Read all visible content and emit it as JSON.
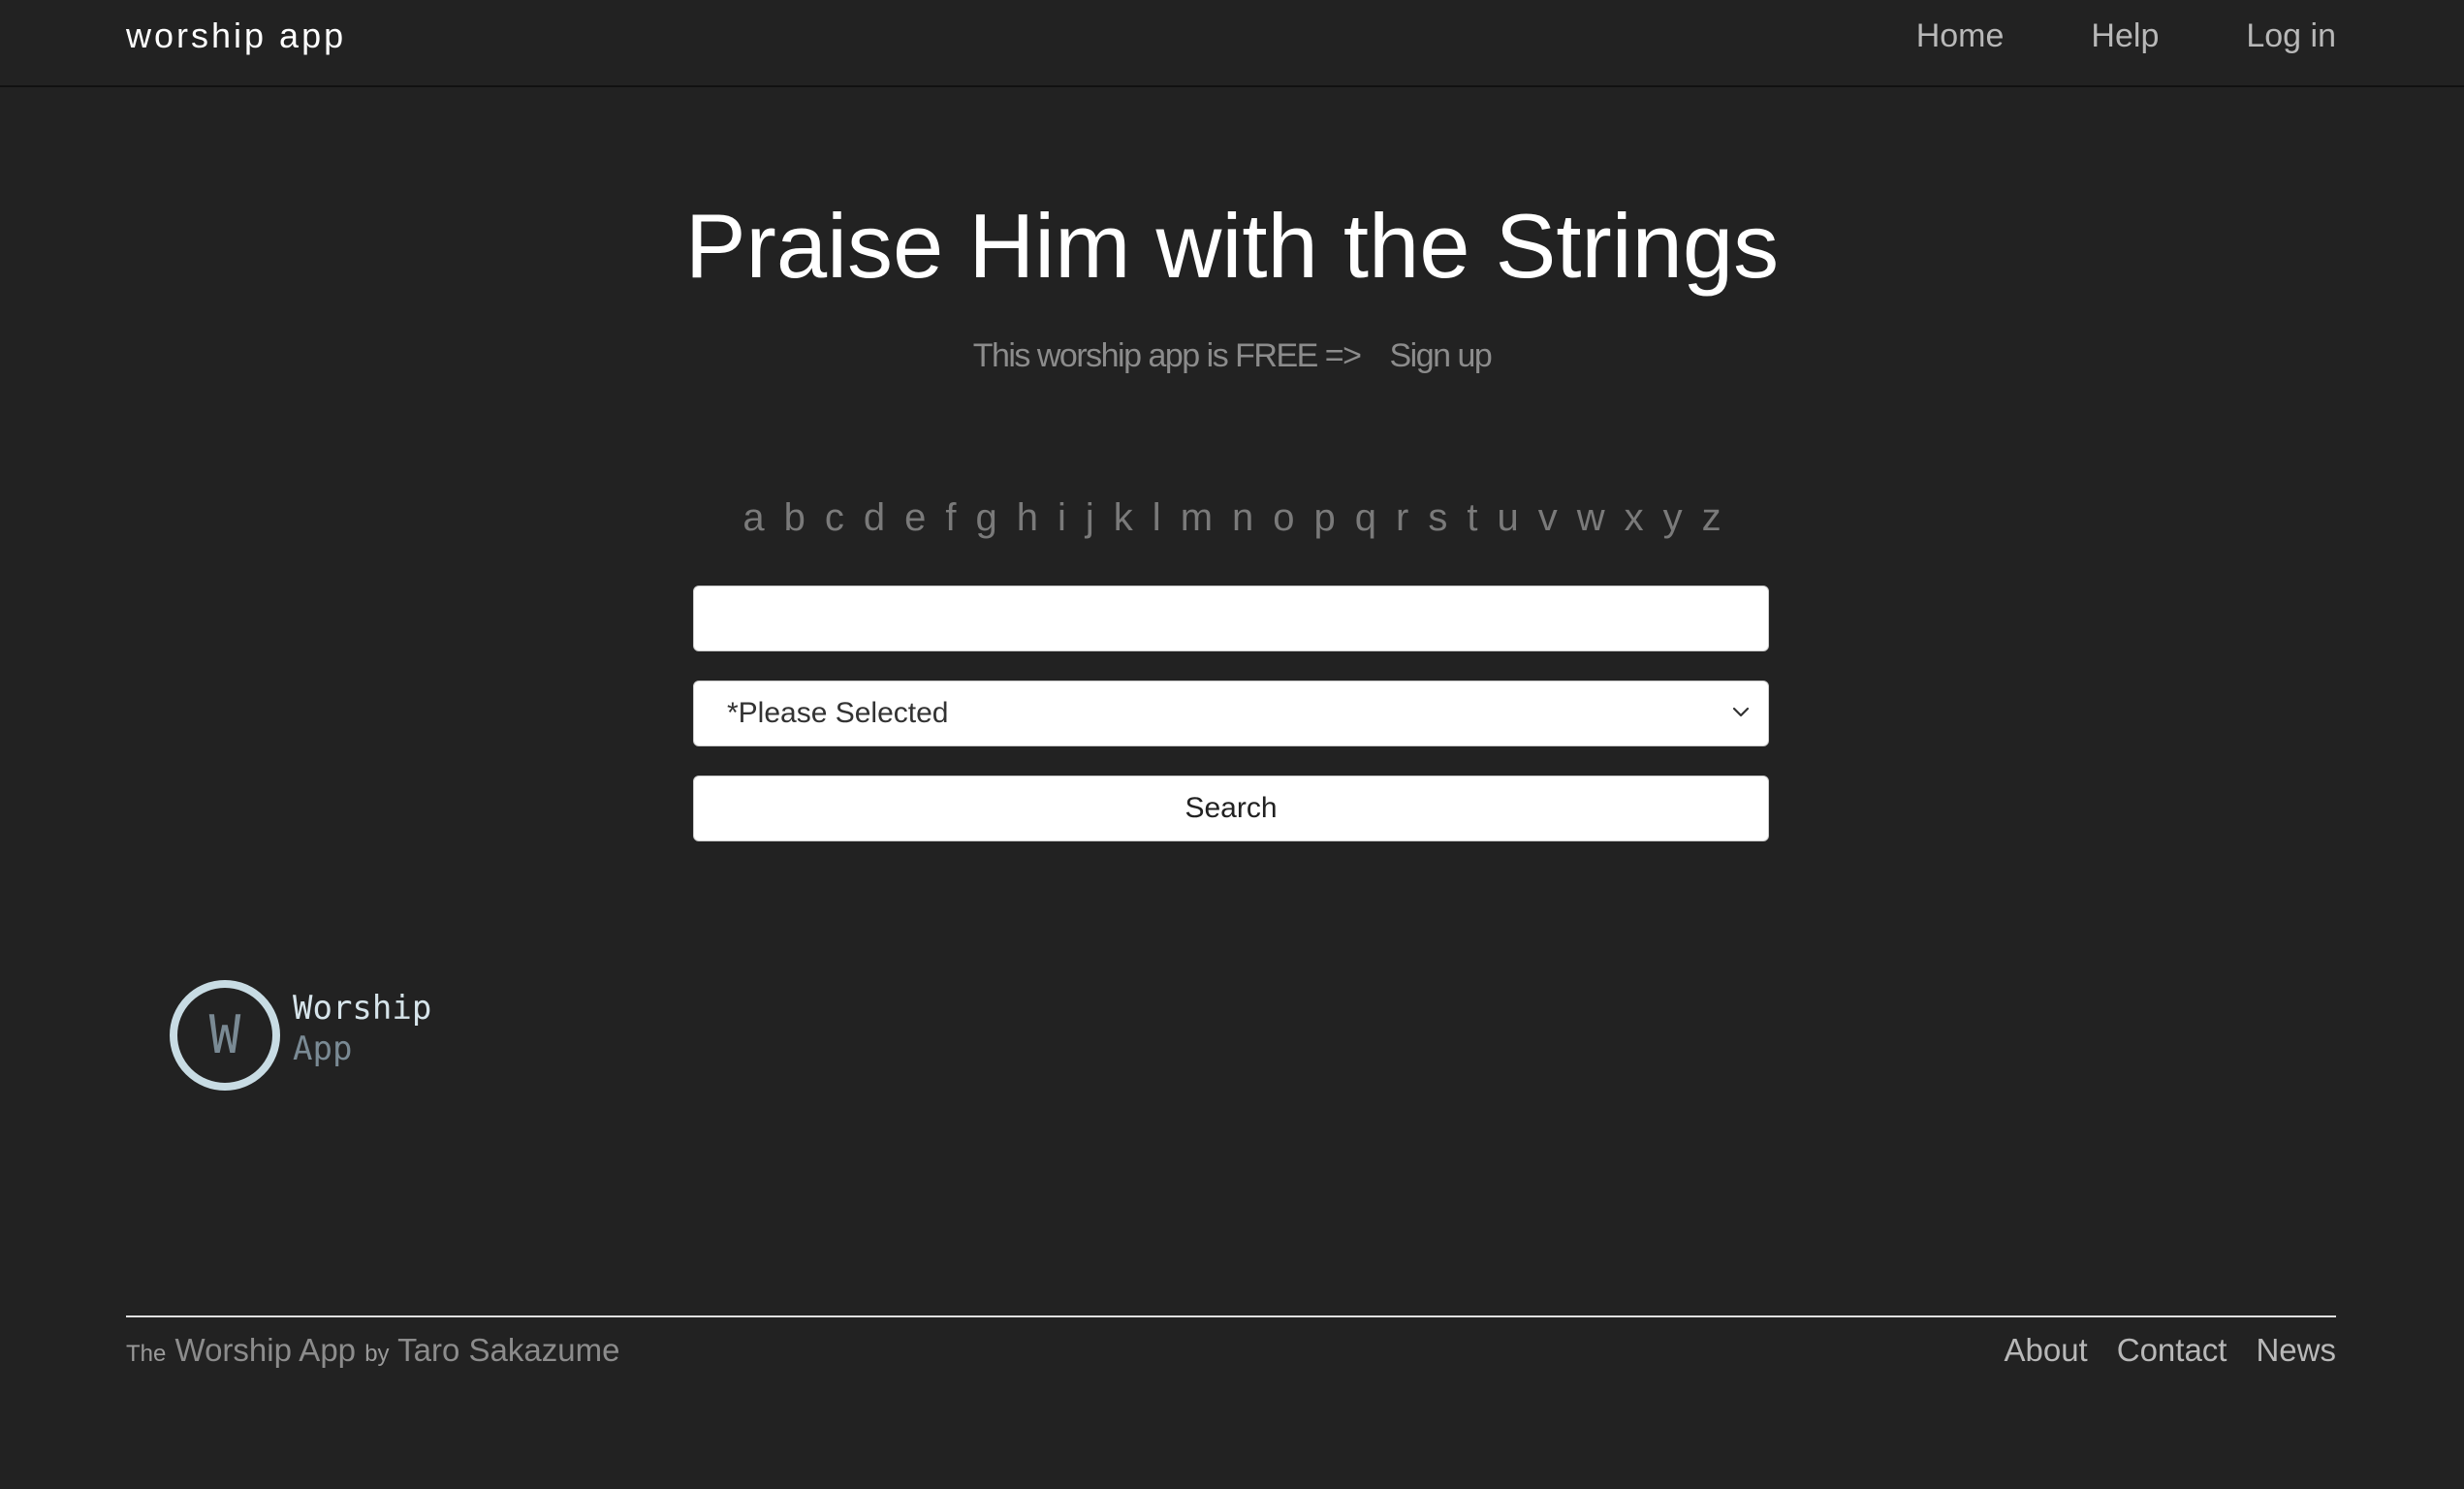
{
  "navbar": {
    "brand": "worship app",
    "links": [
      "Home",
      "Help",
      "Log in"
    ]
  },
  "hero": {
    "title": "Praise Him with the Strings",
    "tagline": "This worship app is FREE =>",
    "signup": "Sign up"
  },
  "alphabet": [
    "a",
    "b",
    "c",
    "d",
    "e",
    "f",
    "g",
    "h",
    "i",
    "j",
    "k",
    "l",
    "m",
    "n",
    "o",
    "p",
    "q",
    "r",
    "s",
    "t",
    "u",
    "v",
    "w",
    "x",
    "y",
    "z"
  ],
  "search": {
    "input_value": "",
    "select_value": "*Please Selected",
    "button_label": "Search"
  },
  "logo": {
    "letter": "W",
    "line1": "Worship",
    "line2": "App"
  },
  "footer": {
    "the": "The",
    "app_name": "Worship App",
    "by": "by",
    "author": "Taro Sakazume",
    "links": [
      "About",
      "Contact",
      "News"
    ]
  },
  "colors": {
    "background": "#222222",
    "logo_ring": "#c8dce4"
  }
}
